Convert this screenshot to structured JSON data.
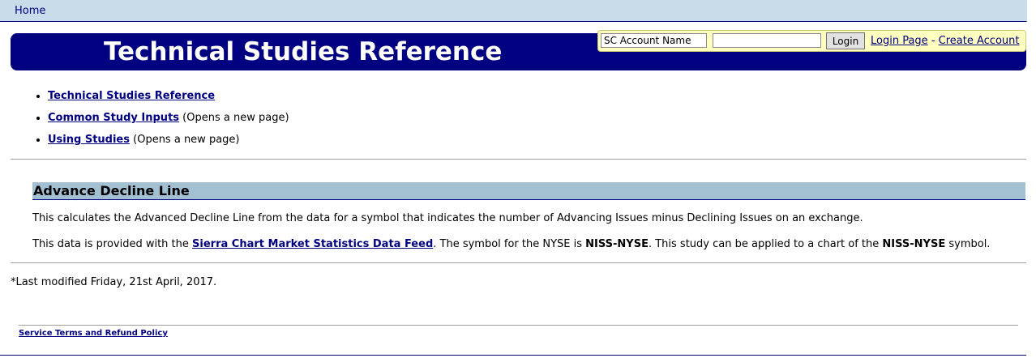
{
  "topnav": {
    "home": "Home"
  },
  "banner": {
    "title": "Technical Studies Reference"
  },
  "login": {
    "account_placeholder": "SC Account Name",
    "login_button": "Login",
    "login_page": "Login Page",
    "separator": "-",
    "create_account": "Create Account"
  },
  "nav": [
    {
      "label": "Technical Studies Reference",
      "note": ""
    },
    {
      "label": "Common Study Inputs",
      "note": "(Opens a new page)"
    },
    {
      "label": "Using Studies",
      "note": "(Opens a new page)"
    }
  ],
  "section": {
    "heading": "Advance Decline Line",
    "para1": "This calculates the Advanced Decline Line from the data for a symbol that indicates the number of Advancing Issues minus Declining Issues on an exchange.",
    "para2_a": "This data is provided with the",
    "para2_link": "Sierra Chart Market Statistics Data Feed",
    "para2_b": ". The symbol for the NYSE is",
    "para2_sym1": "NISS-NYSE",
    "para2_c": ". This study can be applied to a chart of the",
    "para2_sym2": "NISS-NYSE",
    "para2_d": "symbol."
  },
  "last_modified": "*Last modified Friday, 21st April, 2017.",
  "footer": {
    "terms": "Service Terms and Refund Policy"
  }
}
